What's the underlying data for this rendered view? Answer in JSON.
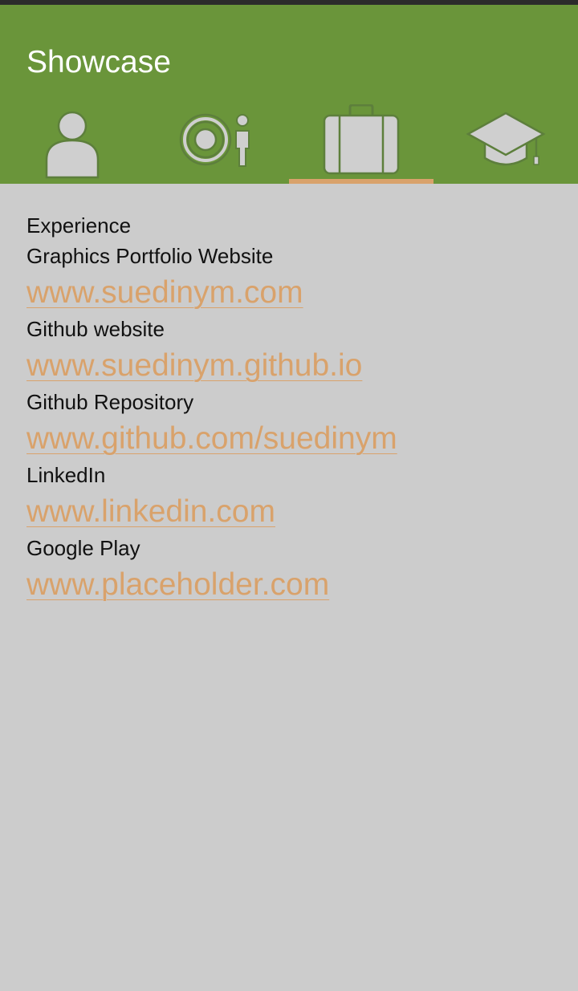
{
  "app": {
    "title": "Showcase"
  },
  "tabs": [
    {
      "name": "profile",
      "icon": "person-icon",
      "selected": false
    },
    {
      "name": "interests",
      "icon": "target-person-icon",
      "selected": false
    },
    {
      "name": "experience",
      "icon": "briefcase-icon",
      "selected": true
    },
    {
      "name": "education",
      "icon": "graduation-cap-icon",
      "selected": false
    }
  ],
  "colors": {
    "app_bar": "#6a953a",
    "background": "#cccccc",
    "accent": "#d9a26b",
    "icon_fill": "#cfcfcf",
    "icon_stroke": "#5d7f3c"
  },
  "content": {
    "heading": "Experience",
    "entries": [
      {
        "label": "Graphics Portfolio Website",
        "link": "www.suedinym.com"
      },
      {
        "label": "Github website",
        "link": "www.suedinym.github.io"
      },
      {
        "label": "Github Repository",
        "link": "www.github.com/suedinym"
      },
      {
        "label": "LinkedIn",
        "link": "www.linkedin.com"
      },
      {
        "label": "Google Play",
        "link": "www.placeholder.com"
      }
    ]
  }
}
